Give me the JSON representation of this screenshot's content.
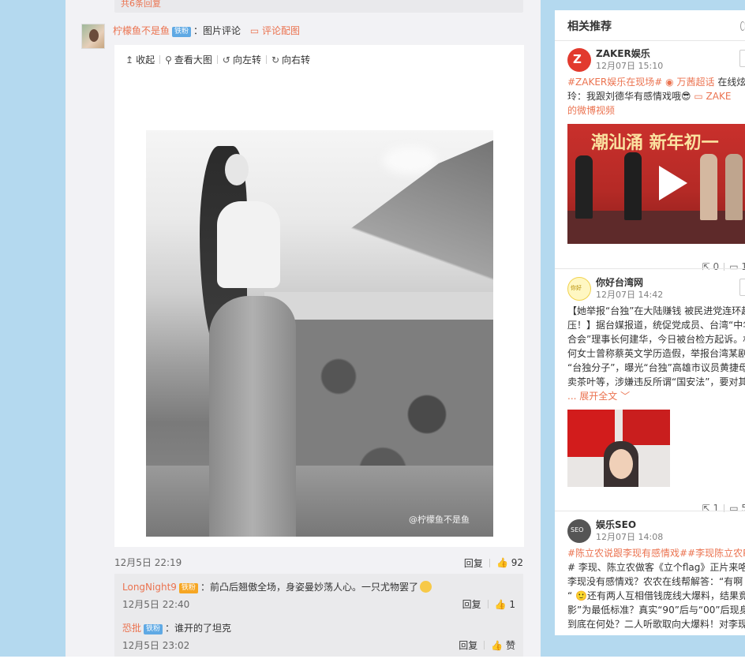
{
  "colors": {
    "accent": "#eb7350",
    "badge": "#5fa9e4",
    "page_bg": "#b4d9ef"
  },
  "prev_tail": "共6条回复",
  "comment": {
    "user": "柠檬鱼不是鱼",
    "badge": "铁粉",
    "text": "：图片评论",
    "image_link": "评论配图",
    "image_link_icon": "image-icon"
  },
  "toolbar": {
    "collapse": "收起",
    "view_large": "查看大图",
    "rotate_left": "向左转",
    "rotate_right": "向右转"
  },
  "photo": {
    "watermark": "@柠檬鱼不是鱼"
  },
  "main_meta": {
    "time": "12月5日 22:19",
    "reply": "回复",
    "likes": "92"
  },
  "replies": [
    {
      "user": "LongNight9",
      "badge": "铁粉",
      "text": "：前凸后翘傲全场，身姿曼妙荡人心。一只尤物罢了",
      "time": "12月5日 22:40",
      "reply": "回复",
      "likes": "1"
    },
    {
      "user": "恐批",
      "badge": "铁粉",
      "text": "：谁开的了坦克",
      "time": "12月5日 23:02",
      "reply": "回复",
      "likes": "赞"
    }
  ],
  "side": {
    "title": "相关推荐",
    "cards": [
      {
        "name": "ZAKER娱乐",
        "time": "12月07日 15:10",
        "line1_topic": "#ZAKER娱乐在现场#",
        "line1_extra": "万茜超话",
        "line1_tail": " 在线炫",
        "line2": "玲：我跟刘德华有感情戏哦",
        "line2_link": "ZAKE",
        "line3": "的微博视频",
        "video_caption": "潮汕涌 新年初一",
        "reposts": "0",
        "comments": "1"
      },
      {
        "name": "你好台湾网",
        "time": "12月07日 14:42",
        "lines": [
          "【她举报“台独”在大陆赚钱 被民进党连环起",
          "压！】据台媒报道，统促党成员、台湾“中华",
          "合会”理事长何建华，今日被台检方起诉。村",
          "何女士曾称蔡英文学历造假，举报台湾某剧",
          "“台独分子”，曝光“台独”高雄市议员黄捷母亲",
          "卖茶叶等，涉嫌违反所谓“国安法”，要对其"
        ],
        "expand": "... 展开全文 ﹀",
        "reposts": "1",
        "comments": "5"
      },
      {
        "name": "娱乐SEO",
        "time": "12月07日 14:08",
        "line1": "#陈立农说跟李现有感情戏##李现陈立农PK",
        "lines": [
          "# 李现、陈立农做客《立个flag》正片来咯~",
          "李现没有感情戏？农农在线帮解答：“有啊",
          "“ 🙂还有两人互相借钱庞线大爆料，结果竟",
          "影”为最低标准？真实“90”后与“00”后现身说",
          "到底在何处？二人听歌取向大爆料！对李现"
        ]
      }
    ]
  }
}
